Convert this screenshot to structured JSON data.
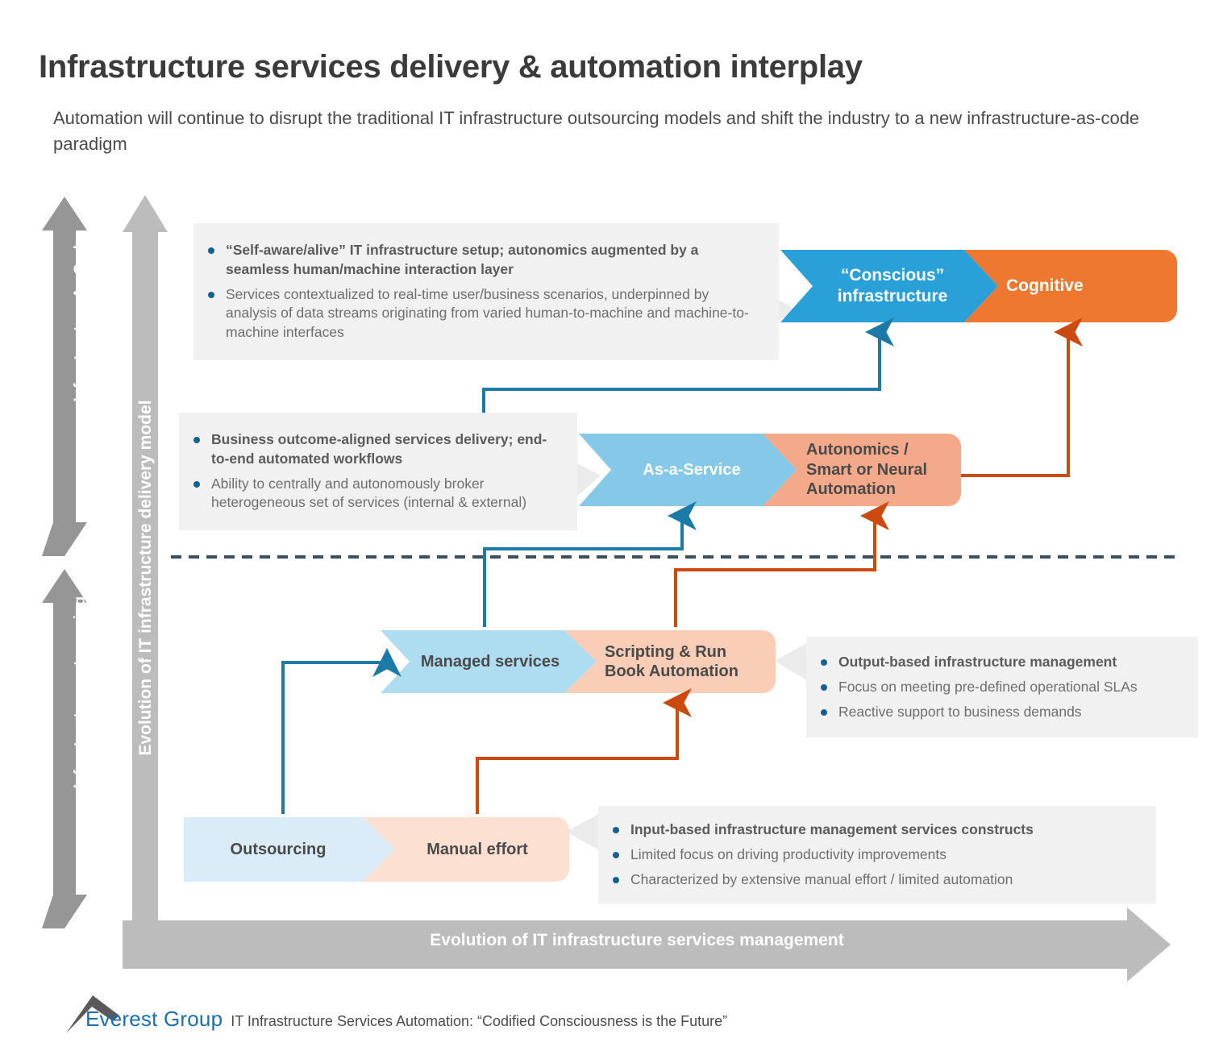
{
  "header": {
    "title": "Infrastructure services delivery & automation interplay",
    "subtitle": "Automation will continue to disrupt the traditional IT infrastructure outsourcing models and shift the industry to a new infrastructure-as-code paradigm"
  },
  "axes": {
    "left_outer_top": "Infrastructure As Code",
    "left_outer_bottom": "Infrastructure outsourcing",
    "left_inner": "Evolution of IT infrastructure delivery model",
    "bottom": "Evolution of IT infrastructure services management"
  },
  "stages": [
    {
      "id": "conscious",
      "left_label": "“Conscious”\ninfrastructure",
      "right_label": "Cognitive",
      "left_color": "#29a0d8",
      "right_color": "#ef7831",
      "left_text_color": "#ffffff",
      "right_text_color": "#ffffff"
    },
    {
      "id": "aas",
      "left_label": "As-a-Service",
      "right_label": "Autonomics /\nSmart or Neural\nAutomation",
      "left_color": "#85c8e8",
      "right_color": "#f4a98a",
      "left_text_color": "#ffffff",
      "right_text_color": "#4a4a4a"
    },
    {
      "id": "managed",
      "left_label": "Managed services",
      "right_label": "Scripting & Run\nBook Automation",
      "left_color": "#aedcf0",
      "right_color": "#f9cdb6",
      "left_text_color": "#4a4a4a",
      "right_text_color": "#4a4a4a"
    },
    {
      "id": "outsourcing",
      "left_label": "Outsourcing",
      "right_label": "Manual effort",
      "left_color": "#d9ecf8",
      "right_color": "#fce0d2",
      "left_text_color": "#4a4a4a",
      "right_text_color": "#4a4a4a"
    }
  ],
  "callouts": {
    "conscious": [
      {
        "text": "“Self-aware/alive” IT infrastructure setup; autonomics  augmented by a seamless human/machine interaction layer",
        "bold": true
      },
      {
        "text": "Services contextualized to real-time user/business scenarios, underpinned by analysis of data streams originating from varied human-to-machine and machine-to-machine interfaces",
        "bold": false
      }
    ],
    "aas": [
      {
        "text": "Business outcome-aligned services delivery; end-to-end automated workflows",
        "bold": true
      },
      {
        "text": "Ability to centrally and autonomously broker heterogeneous set of services (internal & external)",
        "bold": false
      }
    ],
    "managed": [
      {
        "text": "Output-based infrastructure management",
        "bold": true
      },
      {
        "text": "Focus on meeting pre-defined operational SLAs",
        "bold": false
      },
      {
        "text": "Reactive support to business demands",
        "bold": false
      }
    ],
    "outsourcing": [
      {
        "text": "Input-based infrastructure management services constructs",
        "bold": true
      },
      {
        "text": "Limited focus on driving productivity improvements",
        "bold": false
      },
      {
        "text": "Characterized by extensive manual effort / limited automation",
        "bold": false
      }
    ]
  },
  "footer": {
    "brand": "Everest Group",
    "source": "IT Infrastructure Services Automation: “Codified Consciousness is the Future”"
  },
  "colors": {
    "blue": "#29a0d8",
    "orange": "#ef7831",
    "connector_blue": "#1b7ba6",
    "connector_orange": "#cc4a10",
    "axis_gray_dark": "#969696",
    "axis_gray_light": "#bcbcbc",
    "callout_bg": "#f1f1f1",
    "bullet": "#14618f"
  }
}
